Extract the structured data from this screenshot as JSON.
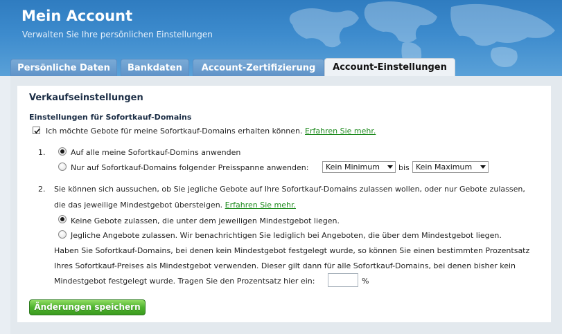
{
  "header": {
    "title": "Mein Account",
    "subtitle": "Verwalten Sie Ihre persönlichen Einstellungen"
  },
  "tabs": [
    {
      "label": "Persönliche Daten",
      "active": false
    },
    {
      "label": "Bankdaten",
      "active": false
    },
    {
      "label": "Account-Zertifizierung",
      "active": false
    },
    {
      "label": "Account-Einstellungen",
      "active": true
    }
  ],
  "section": {
    "title": "Verkaufseinstellungen",
    "subtitle": "Einstellungen für Sofortkauf-Domains",
    "checkbox_label": "Ich möchte Gebote für meine Sofortkauf-Domains erhalten können.",
    "checkbox_checked": true,
    "learn_more": "Erfahren Sie mehr."
  },
  "option1": {
    "number": "1.",
    "radio_all": "Auf alle meine Sofortkauf-Domins anwenden",
    "radio_range": "Nur auf Sofortkauf-Domains folgender Preisspanne anwenden:",
    "min_value": "Kein Minimum",
    "bis": "bis",
    "max_value": "Kein Maximum",
    "selected": "all"
  },
  "option2": {
    "number": "2.",
    "line1": "Sie können sich aussuchen, ob Sie jegliche Gebote auf Ihre Sofortkauf-Domains zulassen wollen, oder nur Gebote zulassen,",
    "line2": "die das jeweilige Mindestgebot übersteigen.",
    "learn_more": "Erfahren Sie mehr.",
    "radio_none": "Keine Gebote zulassen, die unter dem jeweiligen Mindestgebot liegen.",
    "radio_any": "Jegliche Angebote zulassen. Wir benachrichtigen Sie lediglich bei Angeboten, die über dem Mindestgebot liegen.",
    "para1": "Haben Sie Sofortkauf-Domains, bei denen kein Mindestgebot festgelegt wurde, so können Sie einen bestimmten Prozentsatz",
    "para2": "Ihres Sofortkauf-Preises als Mindestgebot verwenden. Dieser gilt dann für alle Sofortkauf-Domains, bei denen bisher kein",
    "para3": "Mindestgebot festgelegt wurde. Tragen Sie den Prozentsatz hier ein:",
    "percent_value": "",
    "percent_sign": "%",
    "selected": "none"
  },
  "save_label": "Änderungen speichern",
  "colors": {
    "header": "#3d8bcd",
    "link": "#1e8a1e",
    "save_button": "#4eb22e"
  }
}
